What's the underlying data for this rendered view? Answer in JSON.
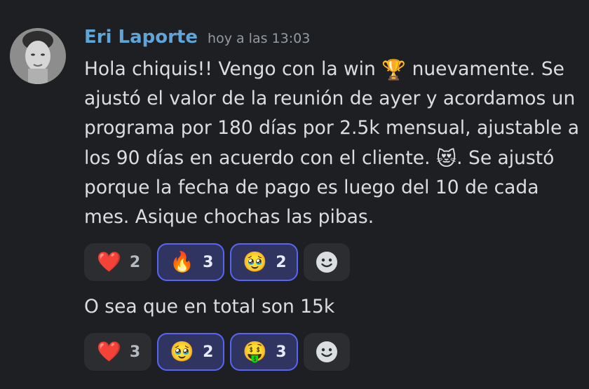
{
  "message": {
    "username": "Eri Laporte",
    "timestamp": "hoy a las 13:03",
    "text_part1": "Hola chiquis!! Vengo con la win ",
    "emoji_trophy": "🏆",
    "text_part2": " nuevamente. Se ajustó el valor de la reunión de ayer y acordamos un programa por 180 días por 2.5k mensual, ajustable a los 90 días en acuerdo con el cliente. ",
    "emoji_heart_eyes_cat": "😻",
    "text_part3": ". Se ajustó porque la fecha de pago es luego del 10 de cada mes. Asique chochas las pibas.",
    "reactions": [
      {
        "emoji": "❤️",
        "count": "2",
        "active": false
      },
      {
        "emoji": "🔥",
        "count": "3",
        "active": true
      },
      {
        "emoji": "🥹",
        "count": "2",
        "active": true
      }
    ]
  },
  "followup": {
    "text": "O sea que en total son 15k",
    "reactions": [
      {
        "emoji": "❤️",
        "count": "3",
        "active": false
      },
      {
        "emoji": "🥹",
        "count": "2",
        "active": true
      },
      {
        "emoji": "🤑",
        "count": "3",
        "active": true
      }
    ]
  },
  "icons": {
    "avatar": "user-avatar-photo",
    "add_reaction": "smiley-add-reaction-icon"
  },
  "colors": {
    "background": "#1e1f22",
    "username": "#60a5d8",
    "timestamp": "#949ba4",
    "text": "#dbdee1",
    "reaction_bg": "#2b2d31",
    "reaction_active_bg": "#2f3460",
    "reaction_active_border": "#5865f2"
  }
}
